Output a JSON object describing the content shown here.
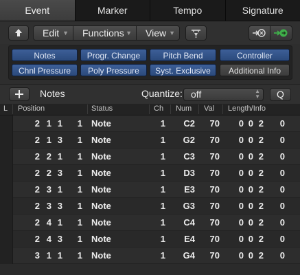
{
  "tabs": [
    "Event",
    "Marker",
    "Tempo",
    "Signature"
  ],
  "toolbar": {
    "up_icon": "up-arrow-icon",
    "edit": "Edit",
    "functions": "Functions",
    "view": "View",
    "filter_icon": "midi-in-icon",
    "catch_icon": "catch-icon",
    "link_icon": "link-icon"
  },
  "filters": {
    "row1": [
      "Notes",
      "Progr. Change",
      "Pitch Bend",
      "Controller"
    ],
    "row2": [
      "Chnl Pressure",
      "Poly Pressure",
      "Syst. Exclusive",
      "Additional Info"
    ]
  },
  "notes_bar": {
    "add_icon": "plus-icon",
    "label": "Notes",
    "quantize_label": "Quantize:",
    "quantize_value": "off",
    "q_button": "Q"
  },
  "columns": {
    "l": "L",
    "position": "Position",
    "status": "Status",
    "ch": "Ch",
    "num": "Num",
    "val": "Val",
    "length": "Length/Info"
  },
  "events": [
    {
      "pos": [
        "2",
        "1",
        "1",
        "1"
      ],
      "status": "Note",
      "ch": "1",
      "num": "C2",
      "val": "70",
      "len": [
        "0",
        "0",
        "2",
        "0"
      ]
    },
    {
      "pos": [
        "2",
        "1",
        "3",
        "1"
      ],
      "status": "Note",
      "ch": "1",
      "num": "G2",
      "val": "70",
      "len": [
        "0",
        "0",
        "2",
        "0"
      ]
    },
    {
      "pos": [
        "2",
        "2",
        "1",
        "1"
      ],
      "status": "Note",
      "ch": "1",
      "num": "C3",
      "val": "70",
      "len": [
        "0",
        "0",
        "2",
        "0"
      ]
    },
    {
      "pos": [
        "2",
        "2",
        "3",
        "1"
      ],
      "status": "Note",
      "ch": "1",
      "num": "D3",
      "val": "70",
      "len": [
        "0",
        "0",
        "2",
        "0"
      ]
    },
    {
      "pos": [
        "2",
        "3",
        "1",
        "1"
      ],
      "status": "Note",
      "ch": "1",
      "num": "E3",
      "val": "70",
      "len": [
        "0",
        "0",
        "2",
        "0"
      ]
    },
    {
      "pos": [
        "2",
        "3",
        "3",
        "1"
      ],
      "status": "Note",
      "ch": "1",
      "num": "G3",
      "val": "70",
      "len": [
        "0",
        "0",
        "2",
        "0"
      ]
    },
    {
      "pos": [
        "2",
        "4",
        "1",
        "1"
      ],
      "status": "Note",
      "ch": "1",
      "num": "C4",
      "val": "70",
      "len": [
        "0",
        "0",
        "2",
        "0"
      ]
    },
    {
      "pos": [
        "2",
        "4",
        "3",
        "1"
      ],
      "status": "Note",
      "ch": "1",
      "num": "E4",
      "val": "70",
      "len": [
        "0",
        "0",
        "2",
        "0"
      ]
    },
    {
      "pos": [
        "3",
        "1",
        "1",
        "1"
      ],
      "status": "Note",
      "ch": "1",
      "num": "G4",
      "val": "70",
      "len": [
        "0",
        "0",
        "2",
        "0"
      ]
    }
  ],
  "colors": {
    "filter_active": "#2f4f85",
    "link_active": "#3c8a3c"
  }
}
